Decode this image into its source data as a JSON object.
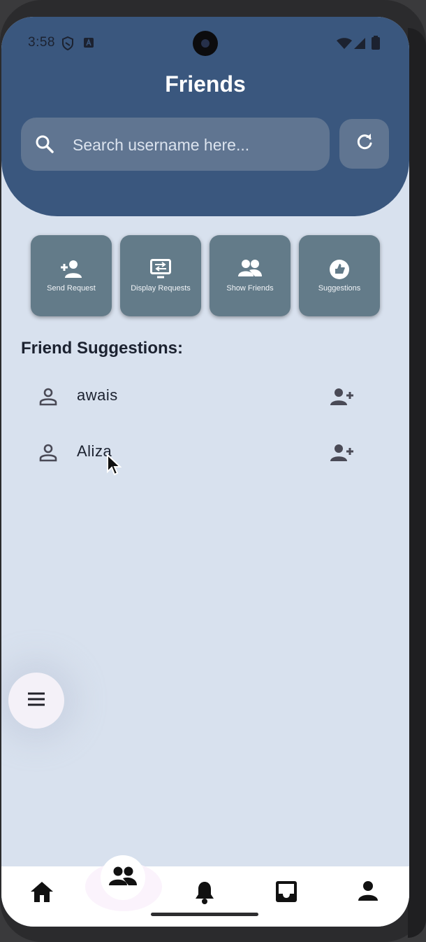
{
  "status_bar": {
    "time": "3:58",
    "icons": [
      "shield-icon",
      "a-icon",
      "wifi-icon",
      "signal-icon",
      "battery-icon"
    ]
  },
  "header": {
    "title": "Friends",
    "search_placeholder": "Search username here...",
    "refresh_icon": "refresh-icon",
    "bg_color": "#3a577e"
  },
  "actions": [
    {
      "label": "Send Request",
      "icon": "person-add-icon"
    },
    {
      "label": "Display Requests",
      "icon": "display-requests-icon"
    },
    {
      "label": "Show Friends",
      "icon": "group-icon"
    },
    {
      "label": "Suggestions",
      "icon": "suggestions-icon"
    }
  ],
  "suggestions": {
    "title": "Friend Suggestions:",
    "items": [
      {
        "name": "awais",
        "icon": "person-outline-icon",
        "action_icon": "person-add-icon"
      },
      {
        "name": "Aliza",
        "icon": "person-outline-icon",
        "action_icon": "person-add-icon"
      }
    ]
  },
  "fab": {
    "icon": "menu-icon"
  },
  "bottom_nav": {
    "items": [
      "home-icon",
      "group-icon",
      "bell-icon",
      "inbox-icon",
      "person-icon"
    ],
    "active": "group-icon"
  }
}
